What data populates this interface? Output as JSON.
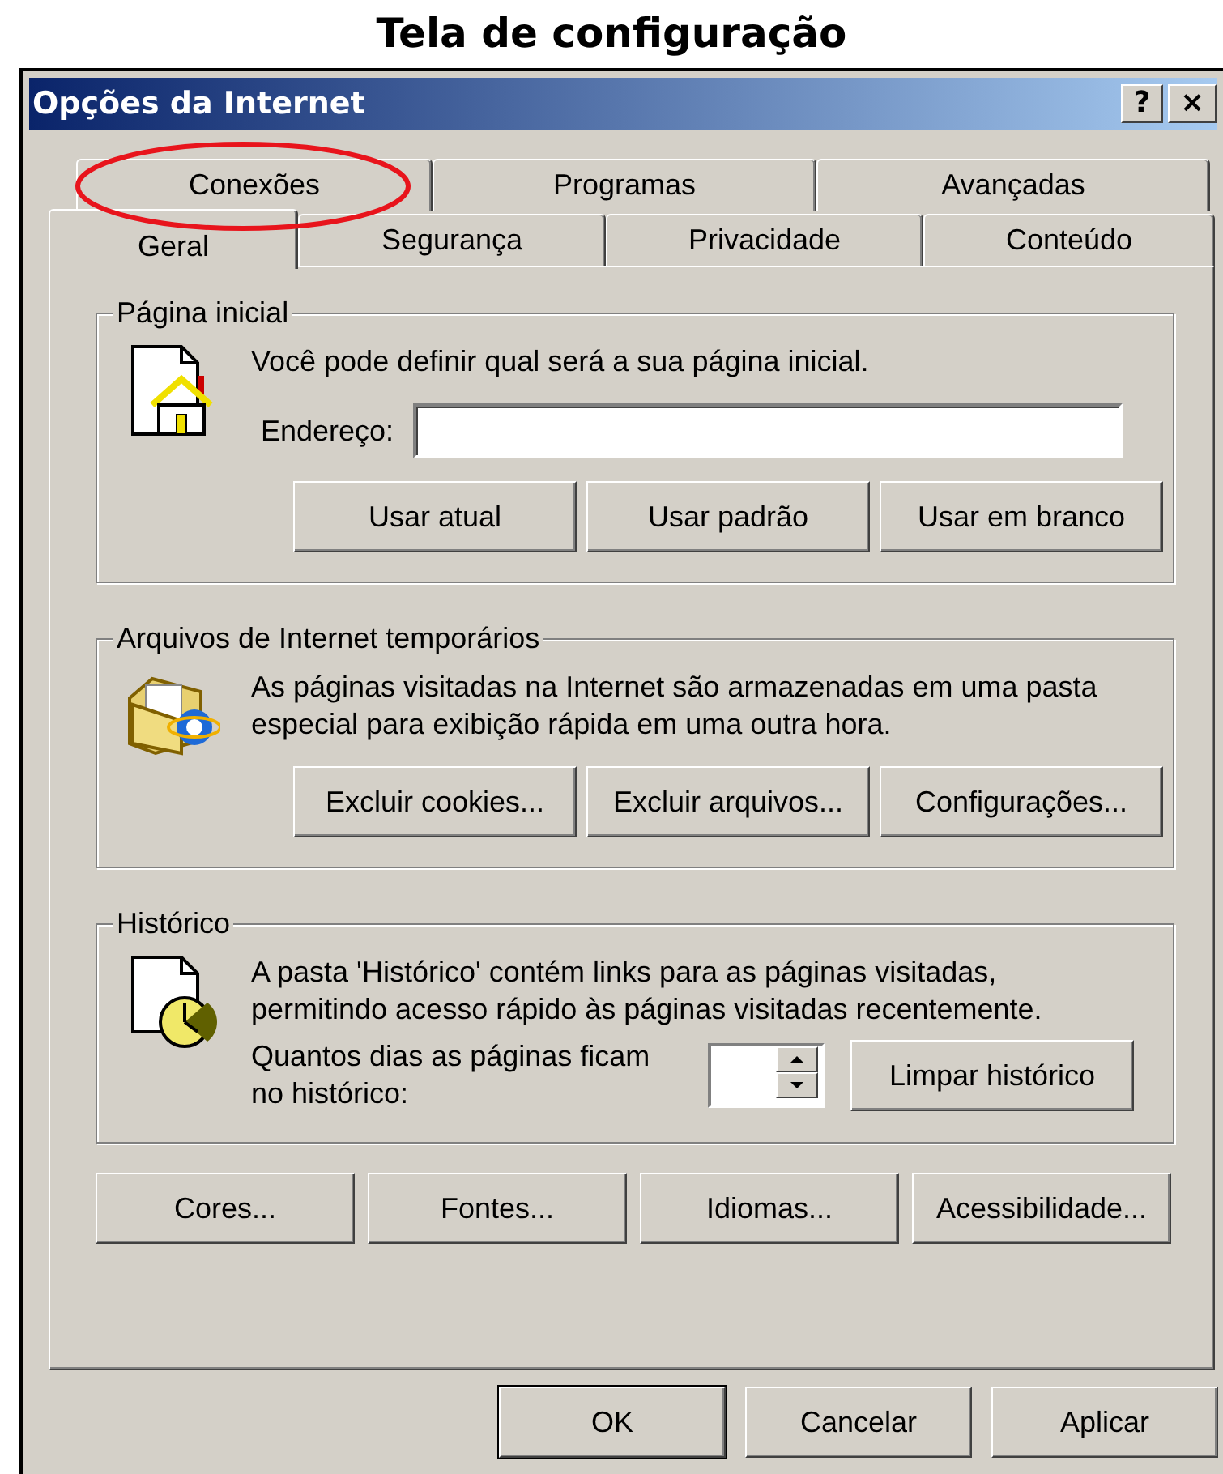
{
  "caption": "Tela de configuração",
  "window": {
    "title": "Opções da Internet",
    "buttons": [
      "?",
      "×"
    ]
  },
  "highlight": {
    "kind": "ellipse"
  },
  "tab_rows": [
    [
      {
        "label": "Conexões",
        "selected": false
      },
      {
        "label": "Programas",
        "selected": false
      },
      {
        "label": "Avançadas",
        "selected": false
      }
    ],
    [
      {
        "label": "Geral",
        "selected": true
      },
      {
        "label": "Segurança",
        "selected": false
      },
      {
        "label": "Privacidade",
        "selected": false
      },
      {
        "label": "Conteúdo",
        "selected": false
      }
    ]
  ],
  "home_page": {
    "title": "Página inicial",
    "text": "Você pode definir qual será a sua página inicial.",
    "address_label": "Endereço:",
    "buttons": [
      "Usar atual",
      "Usar padrão",
      "Usar em branco"
    ]
  },
  "temporary_files": {
    "title": "Arquivos de Internet temporários",
    "text": "As páginas visitadas na Internet são armazenadas em uma pasta especial para exibição rápida em uma outra hora.",
    "buttons": [
      "Excluir cookies...",
      "Excluir arquivos...",
      "Configurações..."
    ]
  },
  "history": {
    "title": "Histórico",
    "text": "A pasta 'Histórico' contém links para as páginas visitadas, permitindo acesso rápido às páginas visitadas recentemente.",
    "days_label": "Quantos dias as páginas ficam no histórico:",
    "button": "Limpar histórico"
  },
  "extra_buttons": [
    "Cores...",
    "Fontes...",
    "Idiomas...",
    "Acessibilidade..."
  ],
  "dialog_buttons": [
    {
      "label": "OK",
      "default": true
    },
    {
      "label": "Cancelar",
      "default": false
    },
    {
      "label": "Aplicar",
      "default": false
    }
  ]
}
